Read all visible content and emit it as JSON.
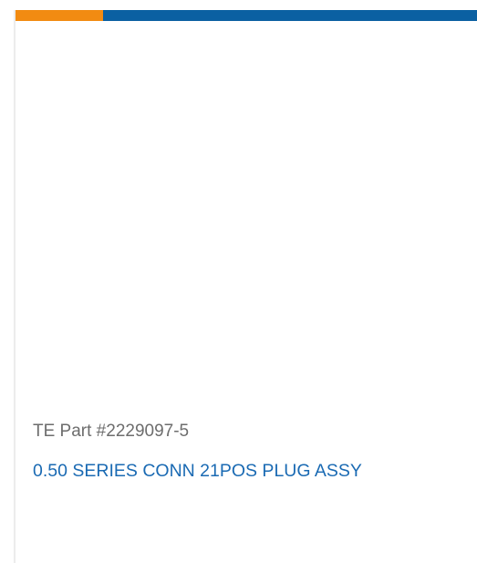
{
  "card": {
    "part_number": "TE Part #2229097-5",
    "title": "0.50 SERIES CONN 21POS PLUG ASSY"
  },
  "colors": {
    "accent_orange": "#f28b12",
    "accent_blue": "#0b60a2",
    "title_blue": "#1a6ab3",
    "part_gray": "#6d6d6d"
  }
}
